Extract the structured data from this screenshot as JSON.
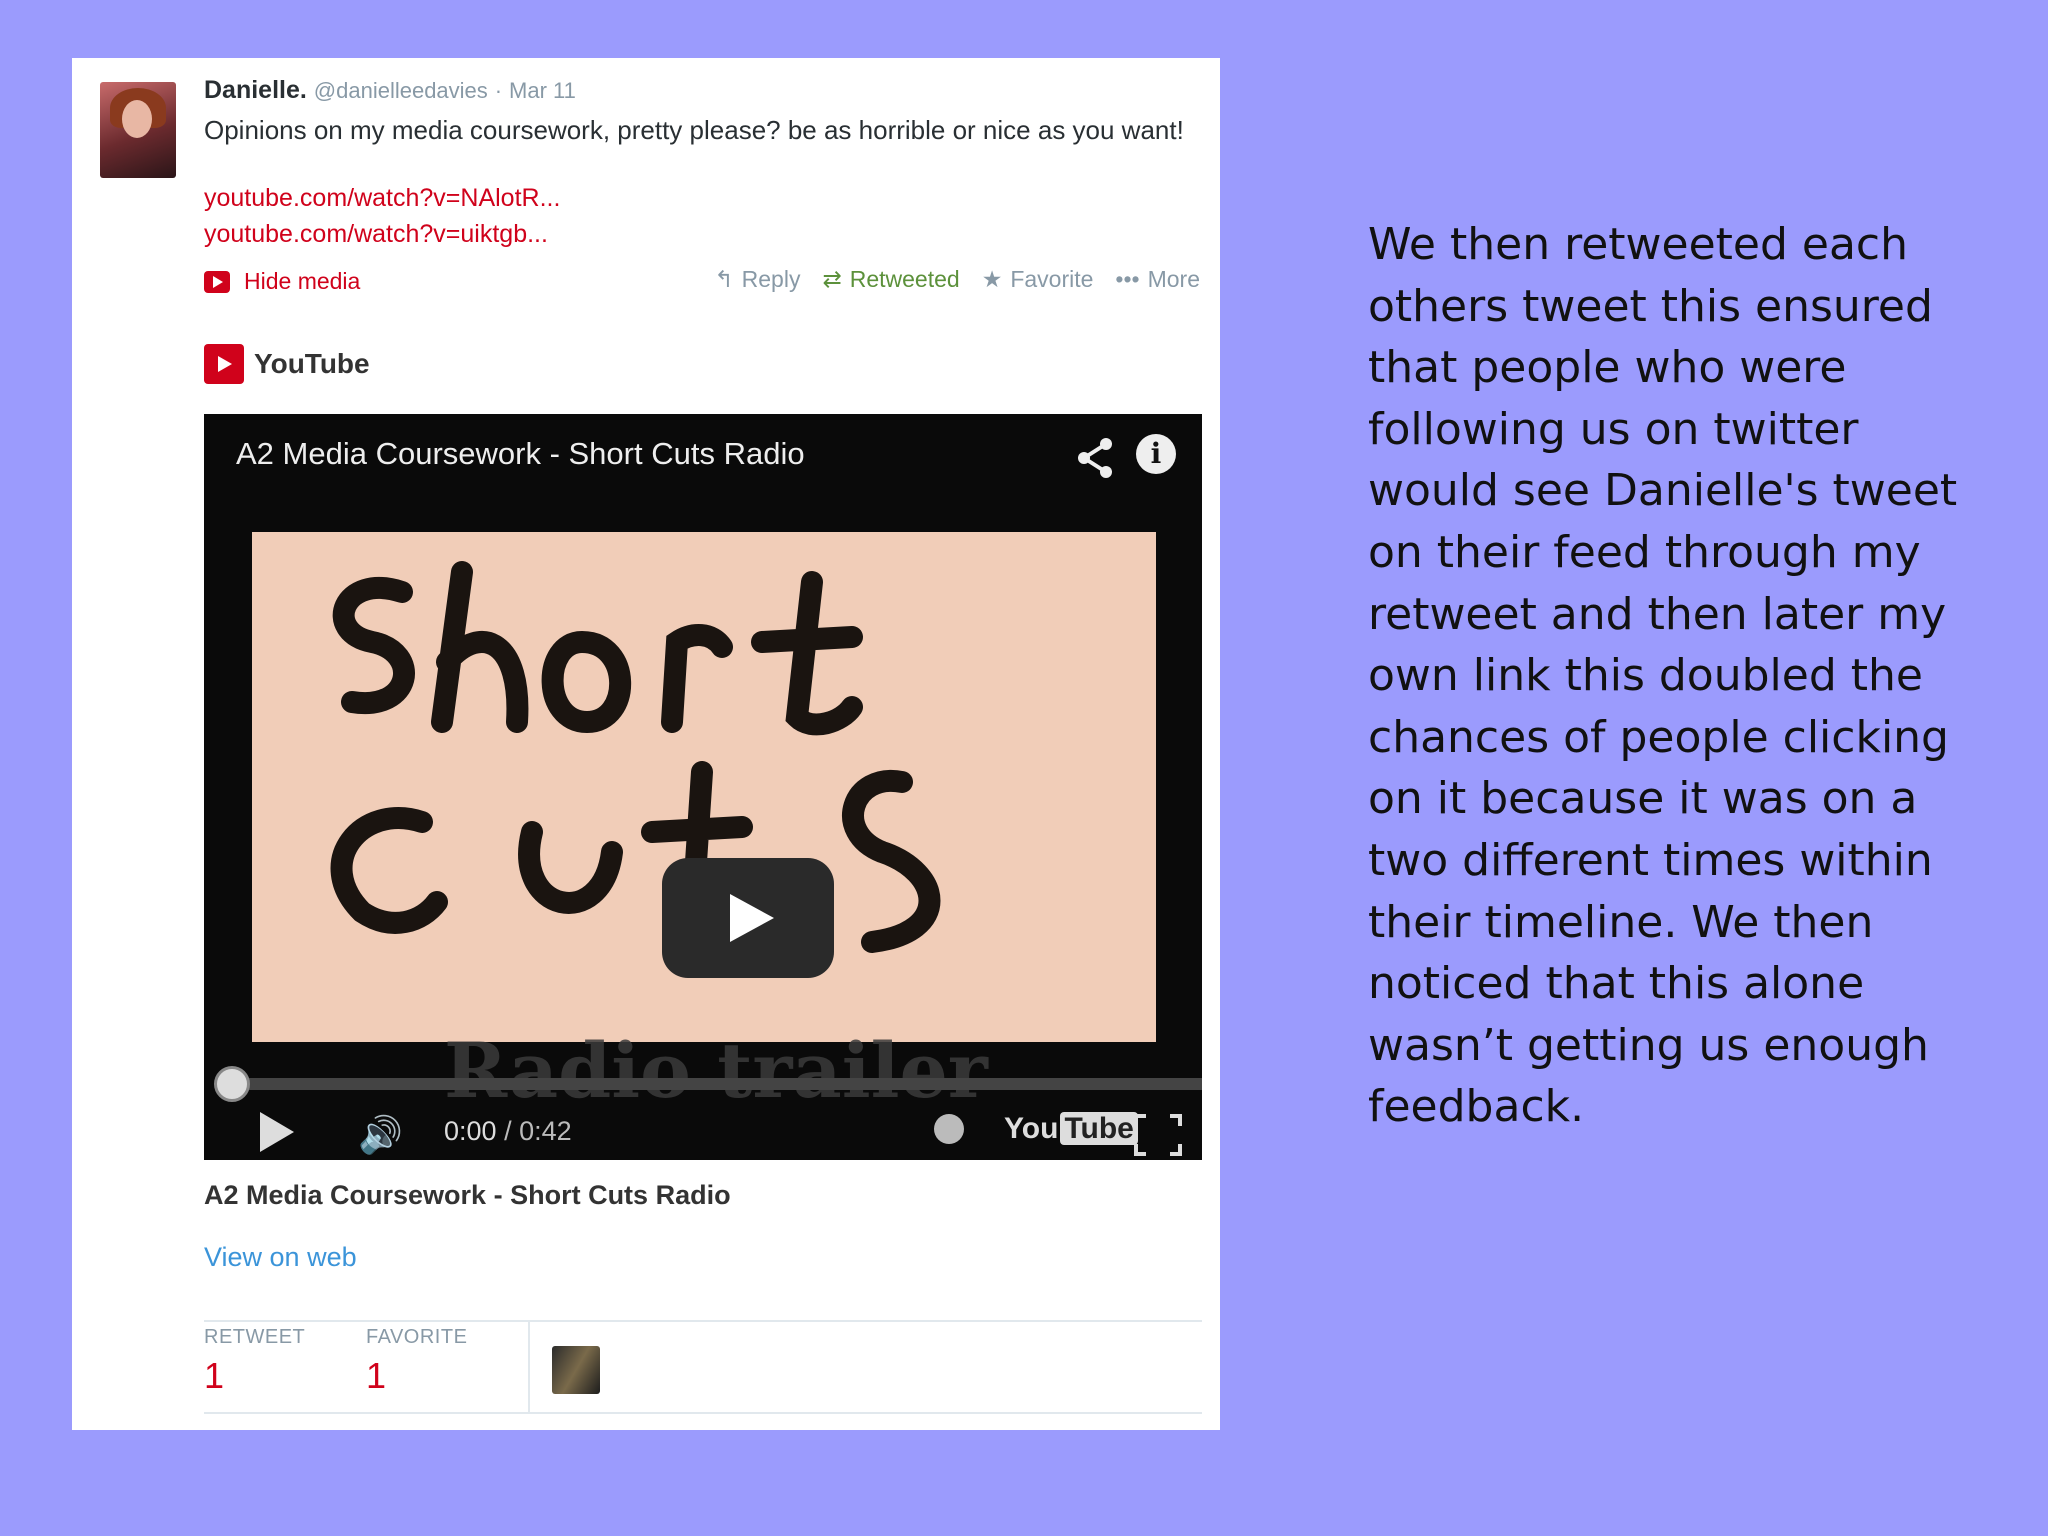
{
  "tweet": {
    "name": "Danielle.",
    "handle": "@danielleedavies",
    "date": "Mar 11",
    "separator": "·",
    "text": "Opinions on my media coursework, pretty please? be as horrible or nice as you want!",
    "links": [
      "youtube.com/watch?v=NAlotR...",
      "youtube.com/watch?v=uiktgb..."
    ],
    "hide_media": "Hide media",
    "actions": {
      "reply": "Reply",
      "retweeted": "Retweeted",
      "favorite": "Favorite",
      "more": "More"
    }
  },
  "media_card": {
    "provider": "YouTube",
    "video_title": "A2 Media Coursework - Short Cuts Radio",
    "overlay_text": "Radio trailer",
    "time_current": "0:00",
    "time_total": "/ 0:42",
    "logo_you": "You",
    "logo_tube": "Tube",
    "caption": "A2 Media Coursework - Short Cuts Radio",
    "view_on_web": "View on web",
    "progress": 0
  },
  "stats": {
    "retweet_label": "RETWEET",
    "retweet_value": "1",
    "favorite_label": "FAVORITE",
    "favorite_value": "1"
  },
  "side_text": "We then retweeted each others tweet this ensured that people who were following us on twitter would see Danielle's tweet on their feed through my retweet and then later my own link this doubled the chances of people clicking on it because it was on a two different times within their timeline. We then noticed that this alone wasn’t getting us enough feedback.",
  "colors": {
    "background": "#9b9bfd",
    "link_red": "#d0021b",
    "retweeted_green": "#5c913b",
    "view_web_blue": "#3b94d9"
  }
}
